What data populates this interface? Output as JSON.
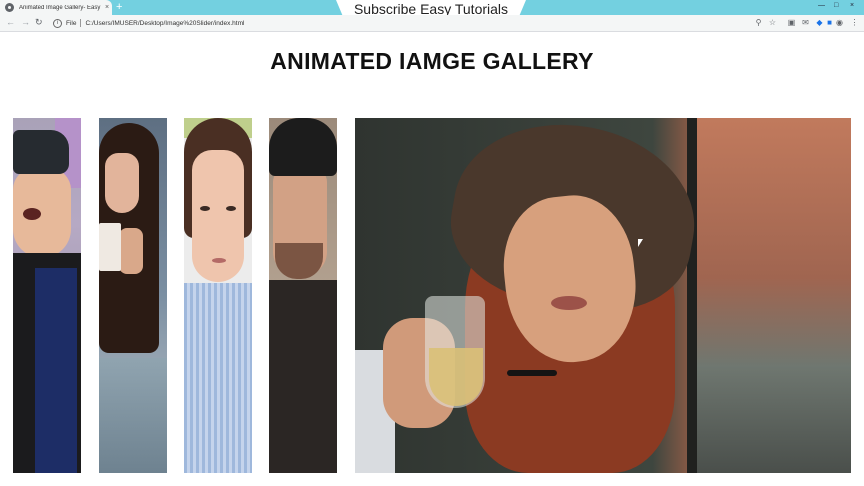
{
  "browser": {
    "tab_title": "Animated Image Gallery- Easy Tu",
    "tab_close": "×",
    "new_tab": "+",
    "promo_text": "Subscribe Easy Tutorials",
    "window_controls": [
      "—",
      "□",
      "×"
    ],
    "address": {
      "scheme_label": "File",
      "url": "C:/Users/IMUSER/Desktop/Image%20Slider/index.html"
    },
    "nav": {
      "back": "←",
      "forward": "→",
      "reload": "↻"
    },
    "toolbar_icons": [
      "zoom-icon",
      "star-icon",
      "camera-icon",
      "mail-icon",
      "extension-icon",
      "extension-icon-2",
      "profile-icon",
      "menu-icon"
    ]
  },
  "page": {
    "title": "ANIMATED IAMGE GALLERY"
  },
  "gallery": {
    "panels": [
      {
        "subject": "man-vr-headset"
      },
      {
        "subject": "woman-coffee-mug"
      },
      {
        "subject": "woman-blue-shirt"
      },
      {
        "subject": "man-black-hat"
      },
      {
        "subject": "woman-hat-wine-glass"
      }
    ]
  },
  "colors": {
    "tabstrip": "#73d0e0",
    "toolbar": "#f4f6f6",
    "title": "#111111"
  }
}
